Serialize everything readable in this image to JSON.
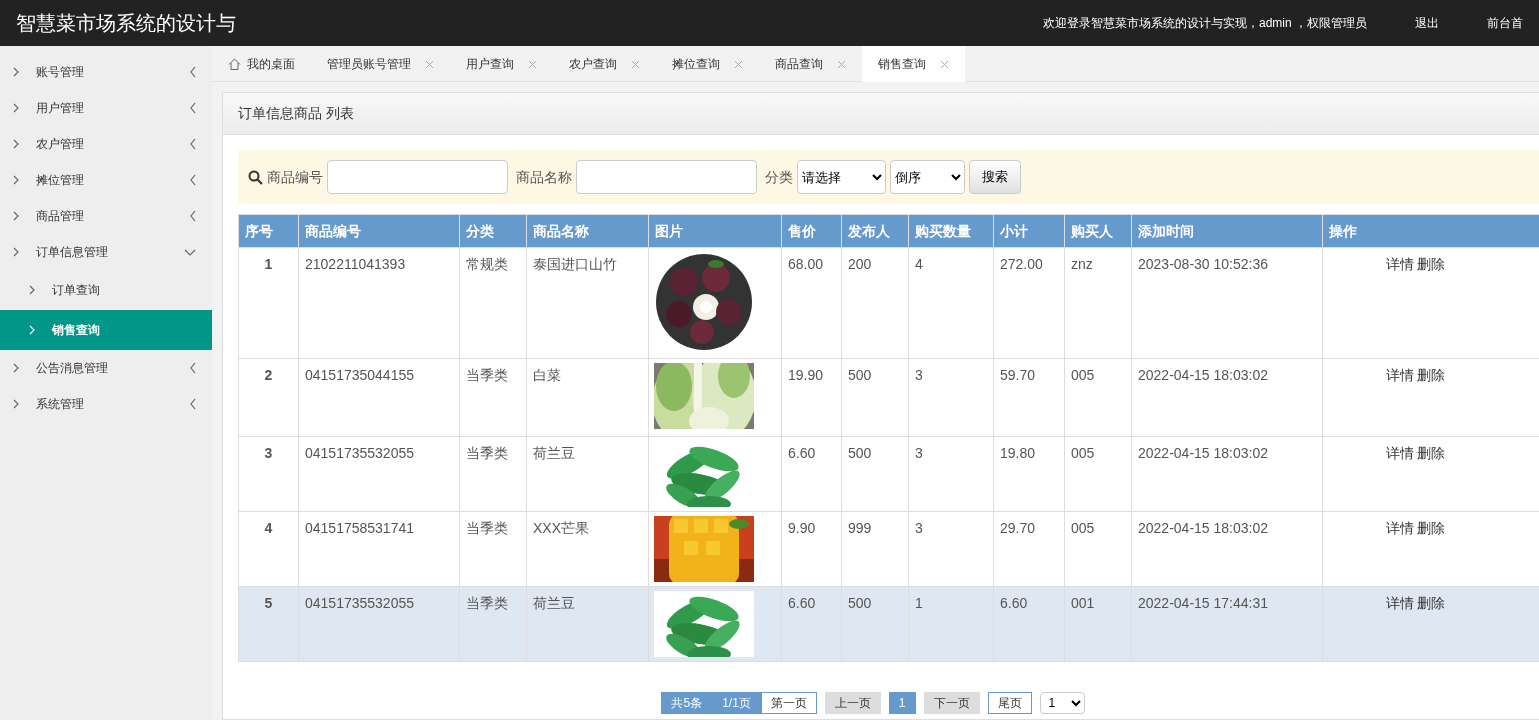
{
  "header": {
    "title": "智慧菜市场系统的设计与",
    "welcome": "欢迎登录智慧菜市场系统的设计与实现，admin ，权限管理员",
    "links": [
      "退出",
      "前台首"
    ]
  },
  "sidebar": {
    "items": [
      {
        "label": "账号管理",
        "expanded": false
      },
      {
        "label": "用户管理",
        "expanded": false
      },
      {
        "label": "农户管理",
        "expanded": false
      },
      {
        "label": "摊位管理",
        "expanded": false
      },
      {
        "label": "商品管理",
        "expanded": false
      },
      {
        "label": "订单信息管理",
        "expanded": true,
        "children": [
          {
            "label": "订单查询",
            "selected": false
          },
          {
            "label": "销售查询",
            "selected": true
          }
        ]
      },
      {
        "label": "公告消息管理",
        "expanded": false
      },
      {
        "label": "系统管理",
        "expanded": false
      }
    ]
  },
  "tabs": [
    {
      "label": "我的桌面",
      "kind": "home",
      "selected": false
    },
    {
      "label": "管理员账号管理",
      "kind": "closable",
      "selected": false
    },
    {
      "label": "用户查询",
      "kind": "closable",
      "selected": false
    },
    {
      "label": "农户查询",
      "kind": "closable",
      "selected": false
    },
    {
      "label": "摊位查询",
      "kind": "closable",
      "selected": false
    },
    {
      "label": "商品查询",
      "kind": "closable",
      "selected": false
    },
    {
      "label": "销售查询",
      "kind": "closable",
      "selected": true
    }
  ],
  "panel": {
    "title": "订单信息商品 列表"
  },
  "search": {
    "fields": [
      {
        "label": "商品编号"
      },
      {
        "label": "商品名称"
      }
    ],
    "category": {
      "label": "分类",
      "value": "请选择"
    },
    "order": {
      "value": "倒序"
    },
    "button": "搜索"
  },
  "table": {
    "columns": [
      "序号",
      "商品编号",
      "分类",
      "商品名称",
      "图片",
      "售价",
      "发布人",
      "购买数量",
      "小计",
      "购买人",
      "添加时间",
      "操作"
    ],
    "rows": [
      {
        "index": "1",
        "code": "2102211041393",
        "category": "常规类",
        "name": "泰国进口山竹",
        "price": "68.00",
        "publisher": "200",
        "quantity": "4",
        "subtotal": "272.00",
        "buyer": "znz",
        "time": "2023-08-30 10:52:36",
        "actions": [
          "详情",
          "删除"
        ],
        "highlighted": false
      },
      {
        "index": "2",
        "code": "04151735044155",
        "category": "当季类",
        "name": "白菜",
        "price": "19.90",
        "publisher": "500",
        "quantity": "3",
        "subtotal": "59.70",
        "buyer": "005",
        "time": "2022-04-15 18:03:02",
        "actions": [
          "详情",
          "删除"
        ],
        "highlighted": false
      },
      {
        "index": "3",
        "code": "04151735532055",
        "category": "当季类",
        "name": "荷兰豆",
        "price": "6.60",
        "publisher": "500",
        "quantity": "3",
        "subtotal": "19.80",
        "buyer": "005",
        "time": "2022-04-15 18:03:02",
        "actions": [
          "详情",
          "删除"
        ],
        "highlighted": false
      },
      {
        "index": "4",
        "code": "04151758531741",
        "category": "当季类",
        "name": "XXX芒果",
        "price": "9.90",
        "publisher": "999",
        "quantity": "3",
        "subtotal": "29.70",
        "buyer": "005",
        "time": "2022-04-15 18:03:02",
        "actions": [
          "详情",
          "删除"
        ],
        "highlighted": false
      },
      {
        "index": "5",
        "code": "04151735532055",
        "category": "当季类",
        "name": "荷兰豆",
        "price": "6.60",
        "publisher": "500",
        "quantity": "1",
        "subtotal": "6.60",
        "buyer": "001",
        "time": "2022-04-15 17:44:31",
        "actions": [
          "详情",
          "删除"
        ],
        "highlighted": true
      }
    ]
  },
  "pagination": {
    "total": "共5条",
    "pages": "1/1页",
    "first": "第一页",
    "prev": "上一页",
    "pages_list": [
      {
        "label": "1",
        "selected": true
      }
    ],
    "next": "下一页",
    "last": "尾页",
    "jump": "1"
  }
}
